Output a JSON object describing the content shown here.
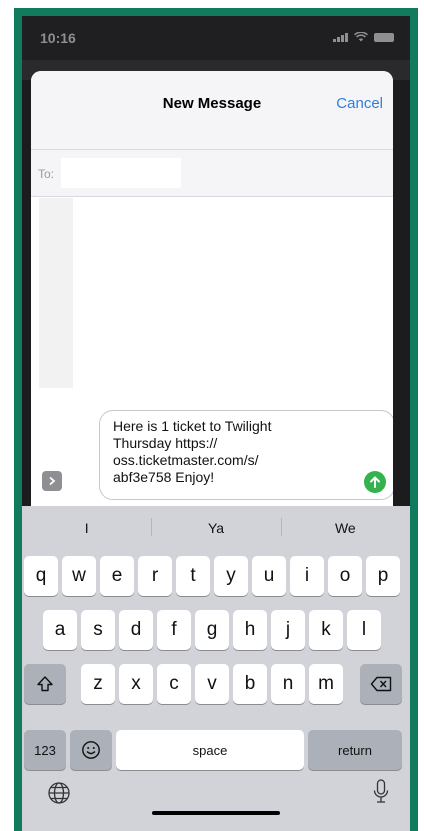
{
  "status_bar": {
    "time": "10:16"
  },
  "compose": {
    "title": "New Message",
    "cancel_label": "Cancel",
    "to_label": "To:",
    "to_value": "",
    "message_text": "Here is 1 ticket to Twilight\nThursday https://\noss.ticketmaster.com/s/\nabf3e758 Enjoy!"
  },
  "keyboard": {
    "suggestions": [
      "I",
      "Ya",
      "We"
    ],
    "row1": [
      "q",
      "w",
      "e",
      "r",
      "t",
      "y",
      "u",
      "i",
      "o",
      "p"
    ],
    "row2": [
      "a",
      "s",
      "d",
      "f",
      "g",
      "h",
      "j",
      "k",
      "l"
    ],
    "row3": [
      "z",
      "x",
      "c",
      "v",
      "b",
      "n",
      "m"
    ],
    "numbers_label": "123",
    "space_label": "space",
    "return_label": "return"
  },
  "colors": {
    "accent": "#2f7de1",
    "send": "#33b24e",
    "frame": "#127a5d"
  }
}
